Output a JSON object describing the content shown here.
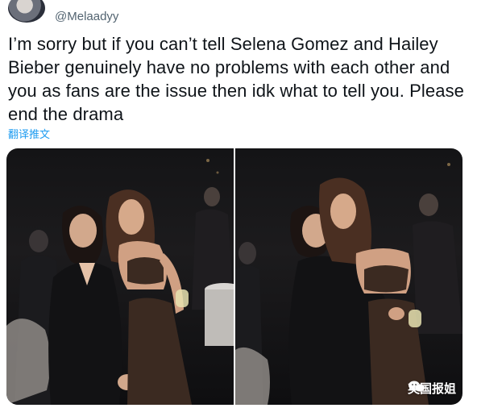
{
  "tweet": {
    "handle": "@Melaadyy",
    "text": "I’m sorry but if you can’t tell Selena Gomez and Hailey Bieber genuinely have no problems with each other and you as fans are the issue then idk what to tell you. Please end the drama",
    "translate_label": "翻译推文"
  },
  "media": {
    "photos": [
      {
        "alt": "photo-1"
      },
      {
        "alt": "photo-2"
      }
    ],
    "watermark_text": "英国报姐"
  },
  "colors": {
    "text": "#0f1419",
    "secondary": "#536471",
    "link": "#1d9bf0"
  }
}
